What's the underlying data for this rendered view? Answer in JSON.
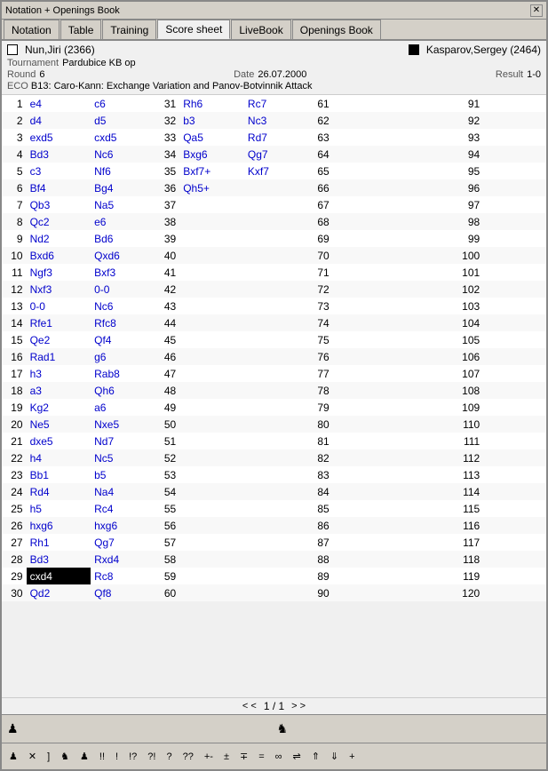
{
  "window": {
    "title": "Notation + Openings Book"
  },
  "tabs": [
    {
      "label": "Notation",
      "active": false
    },
    {
      "label": "Table",
      "active": false
    },
    {
      "label": "Training",
      "active": false
    },
    {
      "label": "Score sheet",
      "active": true
    },
    {
      "label": "LiveBook",
      "active": false
    },
    {
      "label": "Openings Book",
      "active": false
    }
  ],
  "game": {
    "white_player": "Nun,Jiri (2366)",
    "black_player": "Kasparov,Sergey (2464)",
    "tournament": "Pardubice KB op",
    "round": "6",
    "date": "26.07.2000",
    "result": "1-0",
    "eco": "B13: Caro-Kann: Exchange Variation and Panov-Botvinnik Attack"
  },
  "moves": [
    {
      "n": 1,
      "w": "e4",
      "b": "c6"
    },
    {
      "n": 2,
      "w": "d4",
      "b": "d5"
    },
    {
      "n": 3,
      "w": "exd5",
      "b": "cxd5"
    },
    {
      "n": 4,
      "w": "Bd3",
      "b": "Nc6"
    },
    {
      "n": 5,
      "w": "c3",
      "b": "Nf6"
    },
    {
      "n": 6,
      "w": "Bf4",
      "b": "Bg4"
    },
    {
      "n": 7,
      "w": "Qb3",
      "b": "Na5"
    },
    {
      "n": 8,
      "w": "Qc2",
      "b": "e6"
    },
    {
      "n": 9,
      "w": "Nd2",
      "b": "Bd6"
    },
    {
      "n": 10,
      "w": "Bxd6",
      "b": "Qxd6"
    },
    {
      "n": 11,
      "w": "Ngf3",
      "b": "Bxf3"
    },
    {
      "n": 12,
      "w": "Nxf3",
      "b": "0-0"
    },
    {
      "n": 13,
      "w": "0-0",
      "b": "Nc6"
    },
    {
      "n": 14,
      "w": "Rfe1",
      "b": "Rfc8"
    },
    {
      "n": 15,
      "w": "Qe2",
      "b": "Qf4"
    },
    {
      "n": 16,
      "w": "Rad1",
      "b": "g6"
    },
    {
      "n": 17,
      "w": "h3",
      "b": "Rab8"
    },
    {
      "n": 18,
      "w": "a3",
      "b": "Qh6"
    },
    {
      "n": 19,
      "w": "Kg2",
      "b": "a6"
    },
    {
      "n": 20,
      "w": "Ne5",
      "b": "Nxe5"
    },
    {
      "n": 21,
      "w": "dxe5",
      "b": "Nd7"
    },
    {
      "n": 22,
      "w": "h4",
      "b": "Nc5"
    },
    {
      "n": 23,
      "w": "Bb1",
      "b": "b5"
    },
    {
      "n": 24,
      "w": "Rd4",
      "b": "Na4"
    },
    {
      "n": 25,
      "w": "h5",
      "b": "Rc4"
    },
    {
      "n": 26,
      "w": "hxg6",
      "b": "hxg6"
    },
    {
      "n": 27,
      "w": "Rh1",
      "b": "Qg7"
    },
    {
      "n": 28,
      "w": "Bd3",
      "b": "Rxd4"
    },
    {
      "n": 29,
      "w": "cxd4",
      "b": "Rc8",
      "highlight_w": true
    },
    {
      "n": 30,
      "w": "Qd2",
      "b": "Qf8"
    }
  ],
  "col2_moves": [
    {
      "n": 31,
      "w": "Rh6",
      "b": "Rc7"
    },
    {
      "n": 32,
      "w": "b3",
      "b": "Nc3"
    },
    {
      "n": 33,
      "w": "Qa5",
      "b": "Rd7"
    },
    {
      "n": 34,
      "w": "Bxg6",
      "b": "Qg7"
    },
    {
      "n": 35,
      "w": "Bxf7+",
      "b": "Kxf7"
    },
    {
      "n": 36,
      "w": "Qh5+",
      "b": ""
    },
    {
      "n": 37,
      "w": "",
      "b": ""
    },
    {
      "n": 38,
      "w": "",
      "b": ""
    },
    {
      "n": 39,
      "w": "",
      "b": ""
    },
    {
      "n": 40,
      "w": "",
      "b": ""
    },
    {
      "n": 41,
      "w": "",
      "b": ""
    },
    {
      "n": 42,
      "w": "",
      "b": ""
    },
    {
      "n": 43,
      "w": "",
      "b": ""
    },
    {
      "n": 44,
      "w": "",
      "b": ""
    },
    {
      "n": 45,
      "w": "",
      "b": ""
    },
    {
      "n": 46,
      "w": "",
      "b": ""
    },
    {
      "n": 47,
      "w": "",
      "b": ""
    },
    {
      "n": 48,
      "w": "",
      "b": ""
    },
    {
      "n": 49,
      "w": "",
      "b": ""
    },
    {
      "n": 50,
      "w": "",
      "b": ""
    },
    {
      "n": 51,
      "w": "",
      "b": ""
    },
    {
      "n": 52,
      "w": "",
      "b": ""
    },
    {
      "n": 53,
      "w": "",
      "b": ""
    },
    {
      "n": 54,
      "w": "",
      "b": ""
    },
    {
      "n": 55,
      "w": "",
      "b": ""
    },
    {
      "n": 56,
      "w": "",
      "b": ""
    },
    {
      "n": 57,
      "w": "",
      "b": ""
    },
    {
      "n": 58,
      "w": "",
      "b": ""
    },
    {
      "n": 59,
      "w": "",
      "b": ""
    },
    {
      "n": 60,
      "w": "",
      "b": ""
    }
  ],
  "col3_moves": [
    {
      "n": 61
    },
    {
      "n": 62
    },
    {
      "n": 63
    },
    {
      "n": 64
    },
    {
      "n": 65
    },
    {
      "n": 66
    },
    {
      "n": 67
    },
    {
      "n": 68
    },
    {
      "n": 69
    },
    {
      "n": 70
    },
    {
      "n": 71
    },
    {
      "n": 72
    },
    {
      "n": 73
    },
    {
      "n": 74
    },
    {
      "n": 75
    },
    {
      "n": 76
    },
    {
      "n": 77
    },
    {
      "n": 78
    },
    {
      "n": 79
    },
    {
      "n": 80
    },
    {
      "n": 81
    },
    {
      "n": 82
    },
    {
      "n": 83
    },
    {
      "n": 84
    },
    {
      "n": 85
    },
    {
      "n": 86
    },
    {
      "n": 87
    },
    {
      "n": 88
    },
    {
      "n": 89
    },
    {
      "n": 90
    }
  ],
  "col4_moves": [
    {
      "n": 91
    },
    {
      "n": 92
    },
    {
      "n": 93
    },
    {
      "n": 94
    },
    {
      "n": 95
    },
    {
      "n": 96
    },
    {
      "n": 97
    },
    {
      "n": 98
    },
    {
      "n": 99
    },
    {
      "n": 100
    },
    {
      "n": 101
    },
    {
      "n": 102
    },
    {
      "n": 103
    },
    {
      "n": 104
    },
    {
      "n": 105
    },
    {
      "n": 106
    },
    {
      "n": 107
    },
    {
      "n": 108
    },
    {
      "n": 109
    },
    {
      "n": 110
    },
    {
      "n": 111
    },
    {
      "n": 112
    },
    {
      "n": 113
    },
    {
      "n": 114
    },
    {
      "n": 115
    },
    {
      "n": 116
    },
    {
      "n": 117
    },
    {
      "n": 118
    },
    {
      "n": 119
    },
    {
      "n": 120
    }
  ],
  "pagination": {
    "current": "1 / 1",
    "prev_prev": "< <",
    "prev": "",
    "next": "",
    "next_next": "> >"
  },
  "toolbar": {
    "items": [
      "♟",
      "✕",
      "]",
      "♞",
      "♟",
      "!!",
      "!",
      "!?",
      "?!",
      "?",
      "??",
      "+-",
      "±",
      "∓",
      "=",
      "∞",
      "⇌",
      "⇑",
      "⇓",
      "+"
    ]
  }
}
